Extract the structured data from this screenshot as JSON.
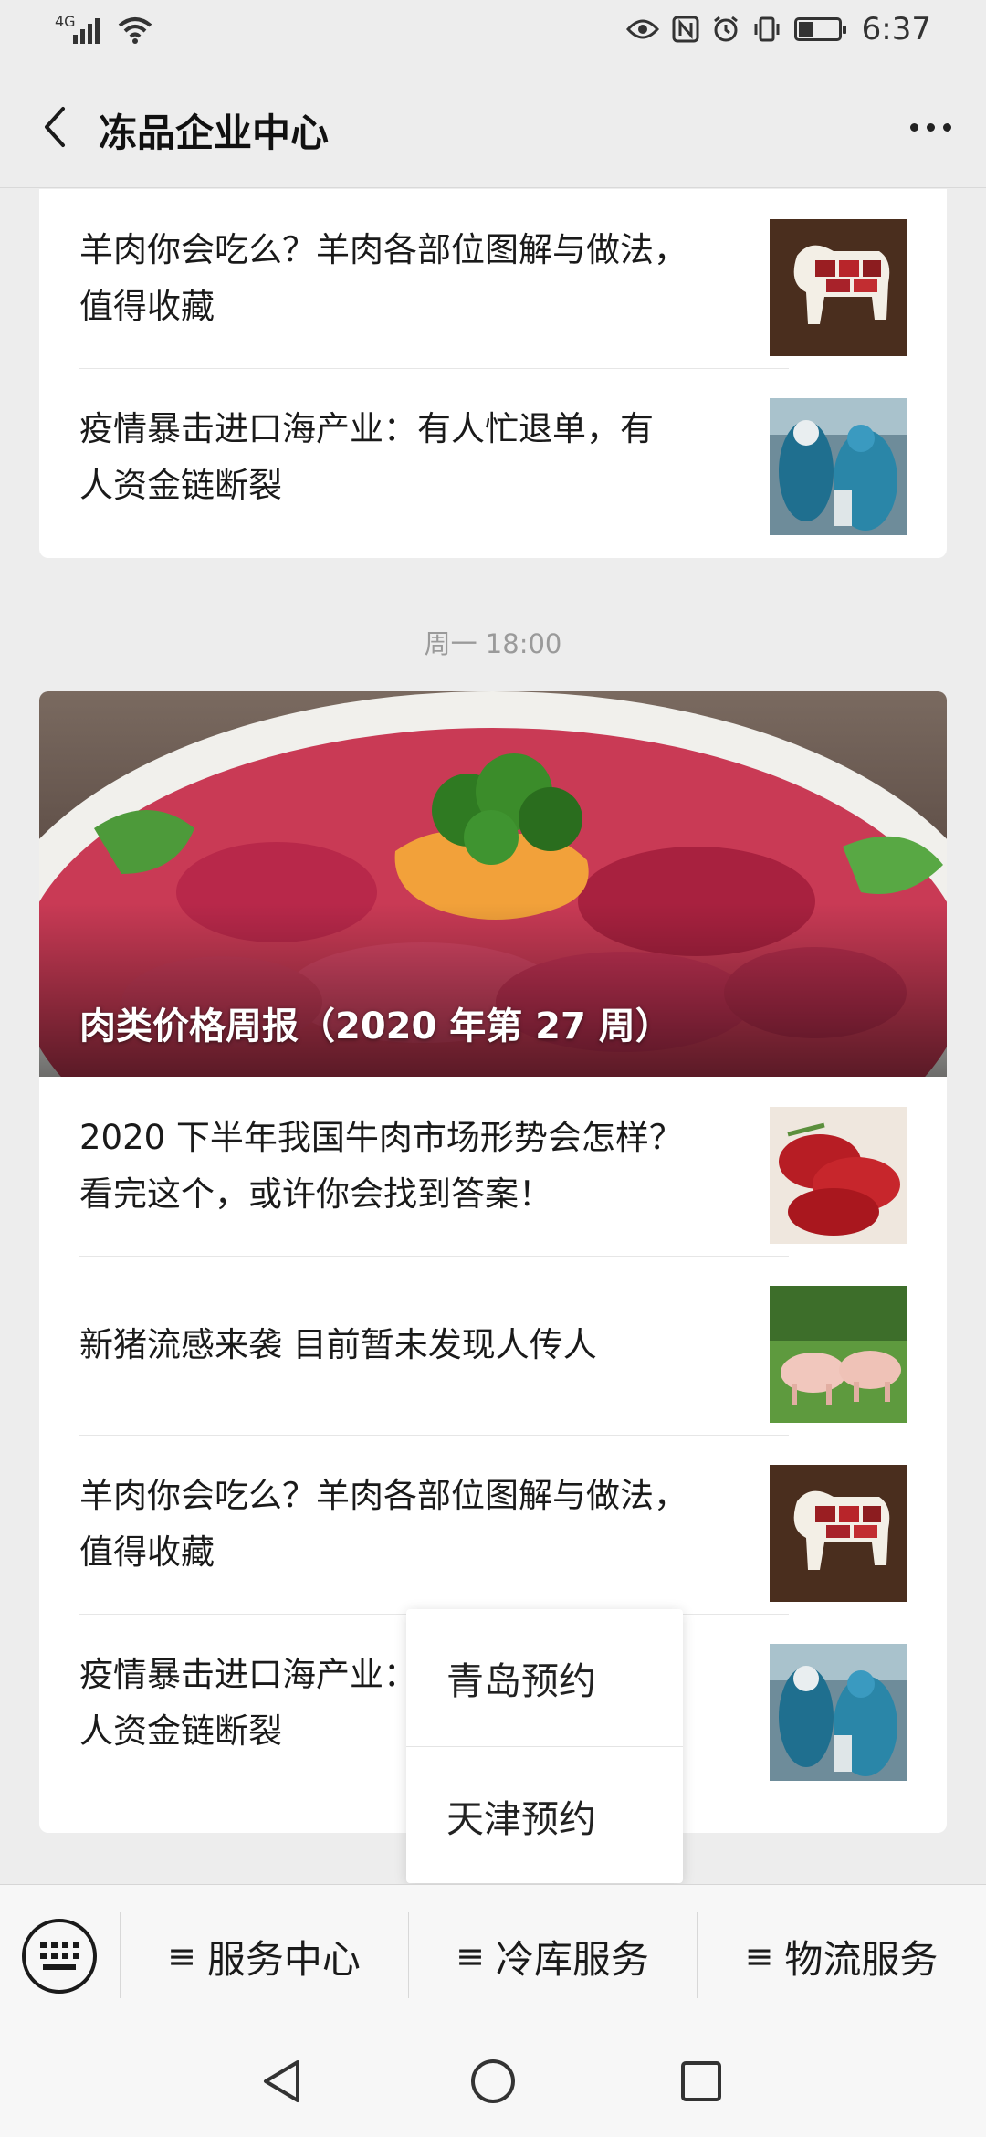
{
  "status_bar": {
    "network": "4G",
    "time": "6:37",
    "icons": [
      "eye-icon",
      "nfc-icon",
      "alarm-icon",
      "vibrate-icon",
      "battery-icon"
    ]
  },
  "nav": {
    "title": "冻品企业中心",
    "back_icon": "chevron-left-icon",
    "more_icon": "more-dots-icon"
  },
  "feed": {
    "top_card": {
      "articles": [
        {
          "line1": "羊肉你会吃么？羊肉各部位图解与做法，",
          "line2": "值得收藏",
          "thumb": "lamb-cuts-chart"
        },
        {
          "line1": "疫情暴击进口海产业：有人忙退单，有",
          "line2": "人资金链断裂",
          "thumb": "seafood-workers"
        }
      ]
    },
    "timestamp": "周一 18:00",
    "main_card": {
      "hero_title": "肉类价格周报（2020 年第 27 周）",
      "articles": [
        {
          "line1": "2020 下半年我国牛肉市场形势会怎样？",
          "line2": "看完这个，或许你会找到答案！",
          "thumb": "beef-steaks"
        },
        {
          "line1": "新猪流感来袭 目前暂未发现人传人",
          "line2": "",
          "thumb": "pigs-on-grass"
        },
        {
          "line1": "羊肉你会吃么？羊肉各部位图解与做法，",
          "line2": "值得收藏",
          "thumb": "lamb-cuts-chart"
        },
        {
          "line1": "疫情暴击进口海产业：有人忙退单，有",
          "line2": "人资金链断裂",
          "thumb": "seafood-workers"
        }
      ]
    }
  },
  "popup_menu": {
    "items": [
      "青岛预约",
      "天津预约"
    ]
  },
  "bottom_menu": {
    "keyboard_icon": "keyboard-icon",
    "items": [
      {
        "label": "服务中心",
        "prefix": "≡"
      },
      {
        "label": "冷库服务",
        "prefix": "≡"
      },
      {
        "label": "物流服务",
        "prefix": "≡"
      }
    ]
  },
  "system_nav": {
    "buttons": [
      "back-triangle-icon",
      "home-circle-icon",
      "recents-square-icon"
    ]
  },
  "colors": {
    "background": "#ededed",
    "card": "#ffffff",
    "text": "#1a1a1a",
    "muted": "#9a9a9a"
  }
}
